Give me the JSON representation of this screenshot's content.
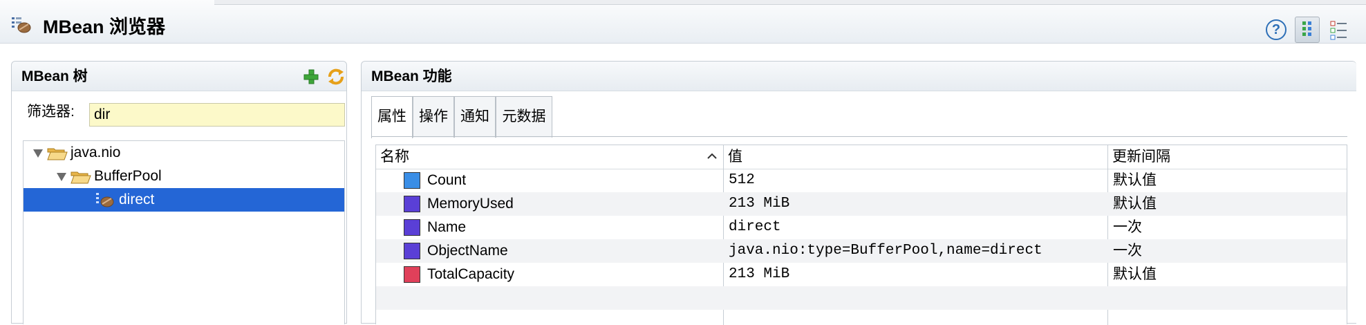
{
  "app": {
    "title": "MBean 浏览器"
  },
  "tree_panel": {
    "title": "MBean 树",
    "filter_label": "筛选器:",
    "filter_value": "dir",
    "items": [
      {
        "label": "java.nio",
        "expanded": true
      },
      {
        "label": "BufferPool",
        "expanded": true
      },
      {
        "label": "direct",
        "selected": true
      }
    ]
  },
  "features_panel": {
    "title": "MBean 功能",
    "tabs": [
      {
        "label": "属性",
        "active": true
      },
      {
        "label": "操作"
      },
      {
        "label": "通知"
      },
      {
        "label": "元数据"
      }
    ],
    "table": {
      "headers": {
        "name": "名称",
        "value": "值",
        "interval": "更新间隔"
      },
      "rows": [
        {
          "name": "Count",
          "value": "512",
          "interval": "默认值",
          "color": "#3a8ee6"
        },
        {
          "name": "MemoryUsed",
          "value": "213 MiB",
          "interval": "默认值",
          "color": "#5a3fd6"
        },
        {
          "name": "Name",
          "value": "direct",
          "interval": "一次",
          "color": "#5a3fd6"
        },
        {
          "name": "ObjectName",
          "value": "java.nio:type=BufferPool,name=direct",
          "interval": "一次",
          "color": "#5a3fd6"
        },
        {
          "name": "TotalCapacity",
          "value": "213 MiB",
          "interval": "默认值",
          "color": "#e0405a"
        }
      ]
    }
  }
}
